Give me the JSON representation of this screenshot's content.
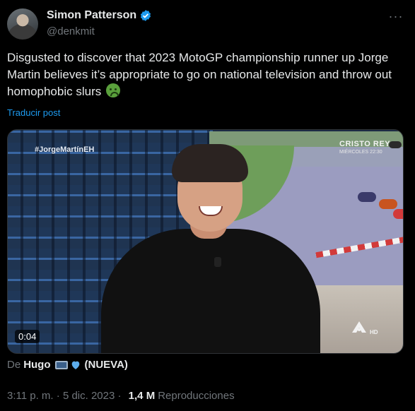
{
  "author": {
    "name": "Simon Patterson",
    "handle": "@denkmit"
  },
  "tweet": {
    "text": "Disgusted to discover that 2023 MotoGP championship runner up Jorge Martin believes it’s appropriate to go on national television and throw out homophobic slurs",
    "translate_label": "Traducir post"
  },
  "media": {
    "hashtag": "#JorgeMartínEH",
    "screen_title": "CRISTO REY",
    "screen_sub": "MIÉRCOLES 22:30",
    "duration": "0:04",
    "channel_badge": "HD"
  },
  "from": {
    "prefix": "De",
    "user": "Hugo",
    "tag": "(NUEVA)"
  },
  "meta": {
    "time": "3:11 p. m.",
    "separator": " · ",
    "date": "5 dic. 2023",
    "separator2": " · ",
    "views": "1,4 M",
    "views_label": "Reproducciones"
  },
  "colors": {
    "background": "#000000",
    "text": "#e7e9ea",
    "muted": "#71767b",
    "link": "#1d9bf0",
    "verified": "#1d9bf0"
  },
  "icons": {
    "verified": "verified-badge-icon",
    "more": "more-options-icon",
    "emoji": "nauseated-face-emoji",
    "laptop": "laptop-emoji",
    "heart": "blue-heart-emoji"
  }
}
